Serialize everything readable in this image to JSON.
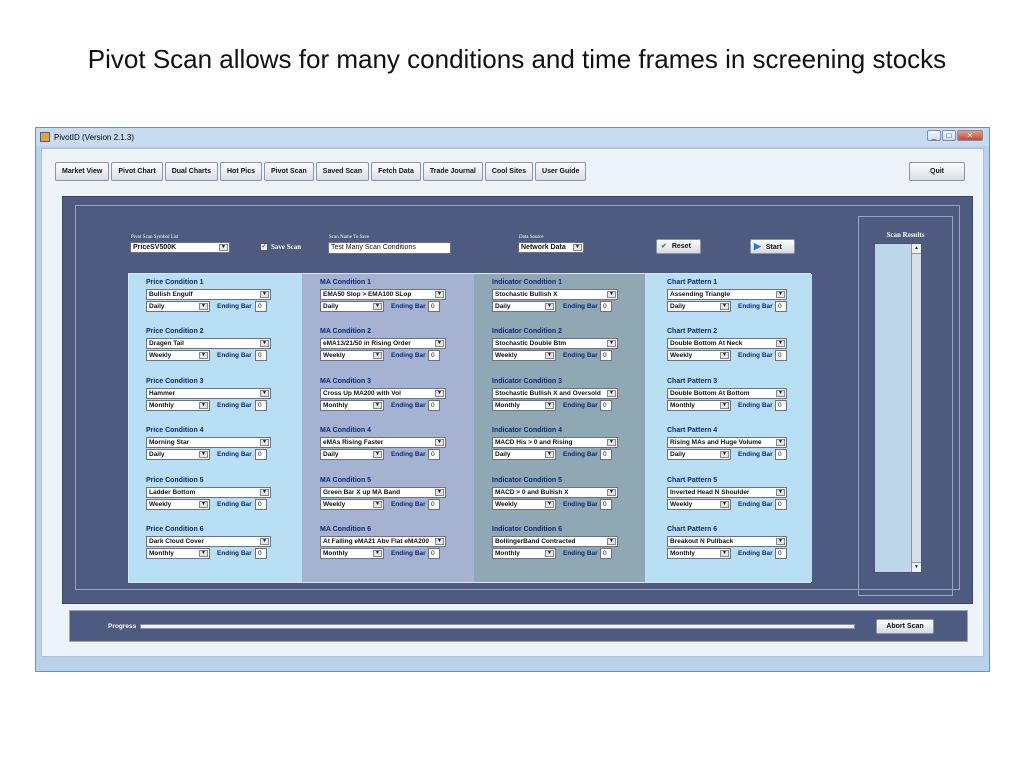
{
  "slide": {
    "title": "Pivot Scan allows for many conditions and time frames in screening stocks"
  },
  "window": {
    "title": "PivotID (Version 2.1.3)"
  },
  "nav": {
    "items": [
      "Market View",
      "Pivot Chart",
      "Dual Charts",
      "Hot Pics",
      "Pivot Scan",
      "Saved Scan",
      "Fetch Data",
      "Trade Journal",
      "Cool Sites",
      "User Guide"
    ],
    "quit": "Quit"
  },
  "scan": {
    "symbol_list_label": "Pivot Scan Symbol List",
    "symbol_list_value": "PriceSV500K",
    "save_scan_label": "Save Scan",
    "save_scan_checked": true,
    "scan_name_label": "Scan Name To Save",
    "scan_name_value": "Test Many Scan Conditions",
    "data_source_label": "Data Source",
    "data_source_value": "Network Data",
    "reset_label": "Reset",
    "start_label": "Start"
  },
  "ending_bar_label": "Ending Bar",
  "columns": [
    {
      "conditions": [
        {
          "label": "Price Condition 1",
          "value": "Bullish Engulf",
          "timeframe": "Daily",
          "ending_bar": "0"
        },
        {
          "label": "Price Condition 2",
          "value": "Dragen Tail",
          "timeframe": "Weekly",
          "ending_bar": "0"
        },
        {
          "label": "Price Condition 3",
          "value": "Hammer",
          "timeframe": "Monthly",
          "ending_bar": "0"
        },
        {
          "label": "Price Condition 4",
          "value": "Morning Star",
          "timeframe": "Daily",
          "ending_bar": "0"
        },
        {
          "label": "Price Condition 5",
          "value": "Ladder Bottom",
          "timeframe": "Weekly",
          "ending_bar": "0"
        },
        {
          "label": "Price Condition 6",
          "value": "Dark Cloud Cover",
          "timeframe": "Monthly",
          "ending_bar": "0"
        }
      ]
    },
    {
      "conditions": [
        {
          "label": "MA Condition 1",
          "value": "EMA50 Slop > EMA100 SLop",
          "timeframe": "Daily",
          "ending_bar": "0"
        },
        {
          "label": "MA Condition 2",
          "value": "eMA13/21/50 in Rising Order",
          "timeframe": "Weekly",
          "ending_bar": "0"
        },
        {
          "label": "MA Condition 3",
          "value": "Cross Up MA200 with Vol",
          "timeframe": "Monthly",
          "ending_bar": "0"
        },
        {
          "label": "MA Condition 4",
          "value": "eMAs Rising Faster",
          "timeframe": "Daily",
          "ending_bar": "0"
        },
        {
          "label": "MA Condition 5",
          "value": "Green Bar X up MA Band",
          "timeframe": "Weekly",
          "ending_bar": "0"
        },
        {
          "label": "MA Condition 6",
          "value": "At Falling eMA21 Abv Flat eMA200",
          "timeframe": "Monthly",
          "ending_bar": "0"
        }
      ]
    },
    {
      "conditions": [
        {
          "label": "Indicator Condition 1",
          "value": "Stochastic Bullish X",
          "timeframe": "Daily",
          "ending_bar": "0"
        },
        {
          "label": "Indicator Condition 2",
          "value": "Stochastic Double Btm",
          "timeframe": "Weekly",
          "ending_bar": "0"
        },
        {
          "label": "Indicator Condition 3",
          "value": "Stochastic Bullish X and Oversold",
          "timeframe": "Monthly",
          "ending_bar": "0"
        },
        {
          "label": "Indicator Condition 4",
          "value": "MACD His > 0 and Rising",
          "timeframe": "Daily",
          "ending_bar": "0"
        },
        {
          "label": "Indicator Condition 5",
          "value": "MACD > 0 and Bullish X",
          "timeframe": "Weekly",
          "ending_bar": "0"
        },
        {
          "label": "Indicator Condition 6",
          "value": "BollingerBand Contracted",
          "timeframe": "Monthly",
          "ending_bar": "0"
        }
      ]
    },
    {
      "conditions": [
        {
          "label": "Chart Pattern 1",
          "value": "Assending Triangle",
          "timeframe": "Daily",
          "ending_bar": "0"
        },
        {
          "label": "Chart Pattern 2",
          "value": "Double Bottom At Neck",
          "timeframe": "Weekly",
          "ending_bar": "0"
        },
        {
          "label": "Chart Pattern 3",
          "value": "Double Bottom At Bottom",
          "timeframe": "Monthly",
          "ending_bar": "0"
        },
        {
          "label": "Chart Pattern 4",
          "value": "Rising MAs and Huge Volume",
          "timeframe": "Daily",
          "ending_bar": "0"
        },
        {
          "label": "Chart Pattern 5",
          "value": "Inverted Head N Shoulder",
          "timeframe": "Weekly",
          "ending_bar": "0"
        },
        {
          "label": "Chart Pattern 6",
          "value": "Breakout N Pullback",
          "timeframe": "Monthly",
          "ending_bar": "0"
        }
      ]
    }
  ],
  "results": {
    "title": "Scan Results"
  },
  "progress": {
    "label": "Progress",
    "value_percent": 0,
    "abort_label": "Abort Scan"
  },
  "colors": {
    "panel": "#4f5a80",
    "col_price": "#b9dff4",
    "col_ma": "#a6b2d2",
    "col_indicator": "#90a8b4",
    "col_pattern": "#b9dff4",
    "label_blue": "#0b2a78"
  },
  "icons": {
    "reset": "check-icon",
    "start": "play-arrow-icon"
  }
}
